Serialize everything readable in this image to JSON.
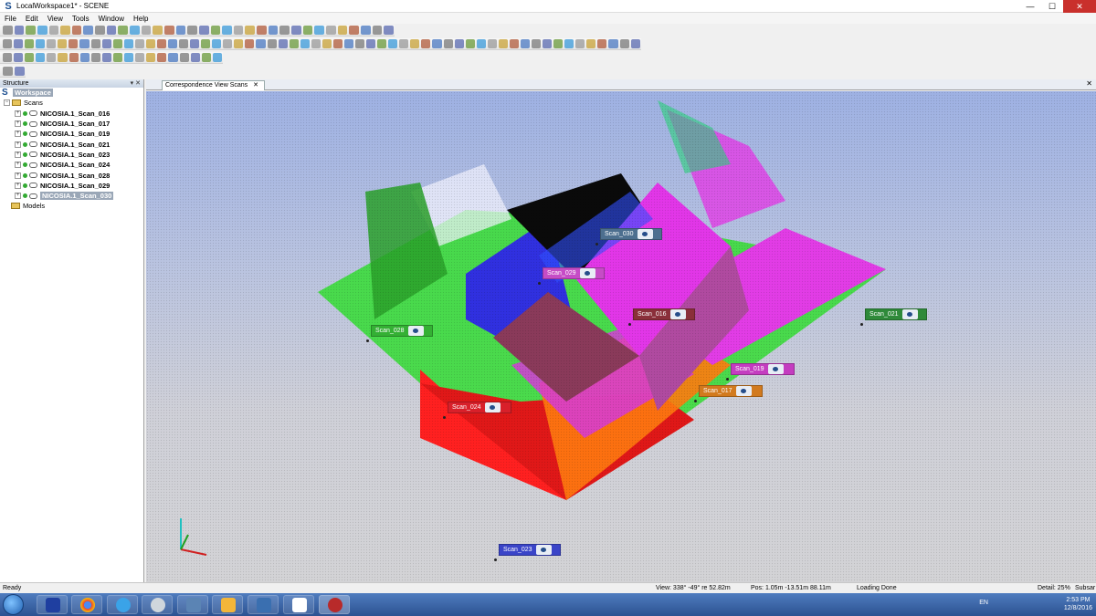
{
  "window": {
    "title": "LocalWorkspace1* - SCENE",
    "logo_letter": "S"
  },
  "window_buttons": {
    "minimize": "—",
    "maximize": "☐",
    "close": "✕"
  },
  "menu": [
    "File",
    "Edit",
    "View",
    "Tools",
    "Window",
    "Help"
  ],
  "structure_panel": {
    "header": "Structure",
    "header_controls": "▾ ✕",
    "workspace_label": "Workspace",
    "scans_label": "Scans",
    "models_label": "Models",
    "scans": [
      "NICOSIA.1_Scan_016",
      "NICOSIA.1_Scan_017",
      "NICOSIA.1_Scan_019",
      "NICOSIA.1_Scan_021",
      "NICOSIA.1_Scan_023",
      "NICOSIA.1_Scan_024",
      "NICOSIA.1_Scan_028",
      "NICOSIA.1_Scan_029",
      "NICOSIA.1_Scan_030"
    ],
    "selected_scan": "NICOSIA.1_Scan_030"
  },
  "view_tab": {
    "label": "Correspondence View Scans",
    "close": "✕"
  },
  "scan_tags": [
    {
      "label": "Scan_030",
      "color": "#4d6f8f"
    },
    {
      "label": "Scan_029",
      "color": "#c64cc6"
    },
    {
      "label": "Scan_016",
      "color": "#8a2f3a"
    },
    {
      "label": "Scan_021",
      "color": "#2f8a3a"
    },
    {
      "label": "Scan_028",
      "color": "#34b034"
    },
    {
      "label": "Scan_019",
      "color": "#c43cc0"
    },
    {
      "label": "Scan_017",
      "color": "#d27a1e"
    },
    {
      "label": "Scan_024",
      "color": "#d8202a"
    },
    {
      "label": "Scan_023",
      "color": "#3a44c8"
    }
  ],
  "status": {
    "ready": "Ready",
    "view": "View: 338° -49° re 52.82m",
    "pos": "Pos: 1.05m -13.51m 88.11m",
    "loading": "Loading Done",
    "detail": "Detail: 25%",
    "subsample": "Subsar"
  },
  "taskbar": {
    "language": "EN",
    "time": "2:53 PM",
    "date": "12/8/2016"
  },
  "colors": {
    "viewport_top": "#9eb1e3",
    "viewport_bottom": "#d3d3d6",
    "taskbar": "#2c5291"
  }
}
